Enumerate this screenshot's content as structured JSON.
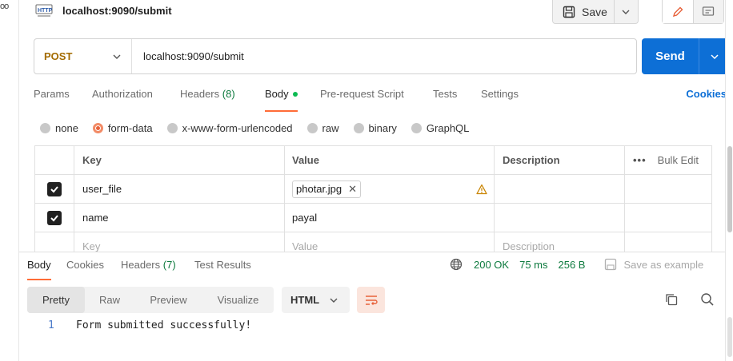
{
  "left_strip": {
    "dots": "oo"
  },
  "header": {
    "title": "localhost:9090/submit",
    "save_label": "Save"
  },
  "request": {
    "method": "POST",
    "url": "localhost:9090/submit",
    "send_label": "Send"
  },
  "request_tabs": {
    "params": "Params",
    "authorization": "Authorization",
    "headers": "Headers",
    "headers_count": "(8)",
    "body": "Body",
    "pre_request": "Pre-request Script",
    "tests": "Tests",
    "settings": "Settings",
    "cookies": "Cookies"
  },
  "body_types": {
    "none": "none",
    "form_data": "form-data",
    "urlencoded": "x-www-form-urlencoded",
    "raw": "raw",
    "binary": "binary",
    "graphql": "GraphQL",
    "selected": "form-data"
  },
  "form_table": {
    "headers": {
      "key": "Key",
      "value": "Value",
      "description": "Description",
      "bulk_edit": "Bulk Edit",
      "more": "•••"
    },
    "rows": [
      {
        "enabled": true,
        "key": "user_file",
        "value": "photar.jpg",
        "type": "file",
        "description": ""
      },
      {
        "enabled": true,
        "key": "name",
        "value": "payal",
        "type": "text",
        "description": ""
      }
    ],
    "placeholder": {
      "key": "Key",
      "value": "Value",
      "description": "Description"
    }
  },
  "response": {
    "tabs": {
      "body": "Body",
      "cookies": "Cookies",
      "headers": "Headers",
      "headers_count": "(7)",
      "test_results": "Test Results"
    },
    "status": "200 OK",
    "time": "75 ms",
    "size": "256 B",
    "save_example": "Save as example",
    "view_modes": [
      "Pretty",
      "Raw",
      "Preview",
      "Visualize"
    ],
    "active_view": "Pretty",
    "format": "HTML",
    "lines": [
      {
        "number": "1",
        "text": "Form submitted successfully!"
      }
    ]
  },
  "colors": {
    "accent": "#ff6c37",
    "send": "#0d6fd6",
    "method_post": "#a36b00",
    "status_ok": "#0d7a3e"
  }
}
